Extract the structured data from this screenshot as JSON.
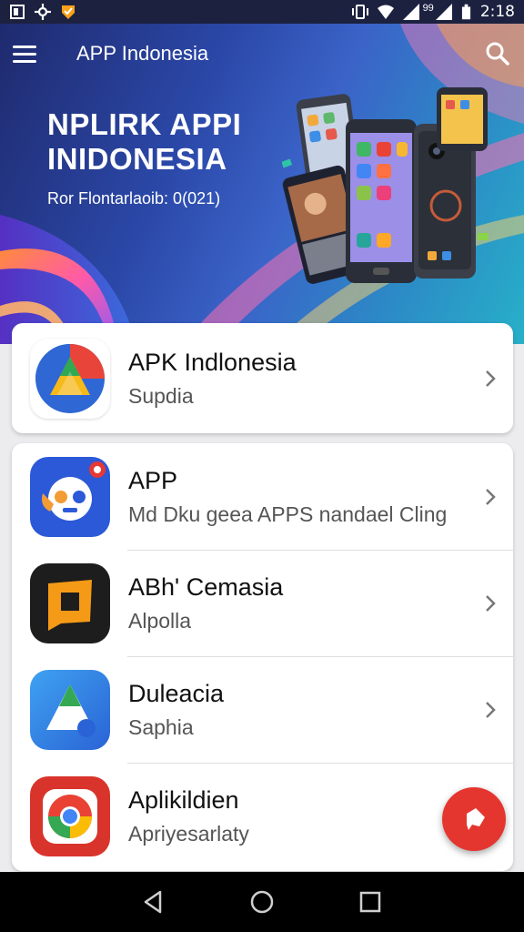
{
  "status_bar": {
    "network_label": "99",
    "time": "2:18",
    "icons": [
      "notification-icon",
      "settings-icon",
      "shield-icon",
      "vibrate-icon",
      "wifi-icon",
      "signal-icon",
      "battery-icon"
    ]
  },
  "header": {
    "title": "APP Indonesia",
    "menu_icon": "hamburger-menu-icon",
    "search_icon": "search-icon"
  },
  "hero": {
    "title_line1": "NPLIRK APPI",
    "title_line2": "INIDONESIA",
    "subtitle": "Ror Flontarlaoib: 0(021)",
    "colors": {
      "gradient_start": "#1f2a6e",
      "gradient_end": "#27b0c8"
    }
  },
  "featured": {
    "title": "APK Indlonesia",
    "subtitle": "Supdia",
    "icon": "google-drive-style-icon"
  },
  "apps": [
    {
      "title": "APP",
      "subtitle": "Md Dku geea APPS nandael Cling",
      "icon": "blue-chat-bot-icon"
    },
    {
      "title": "ABh' Cemasia",
      "subtitle": "Alpolla",
      "icon": "orange-square-icon"
    },
    {
      "title": "Duleacia",
      "subtitle": "Saphia",
      "icon": "blue-triangle-icon"
    },
    {
      "title": "Aplikildien",
      "subtitle": "Apriyesarlaty",
      "icon": "chrome-style-icon"
    }
  ],
  "fab": {
    "icon": "pin-icon",
    "color": "#e5352f"
  },
  "nav": {
    "back_icon": "back-triangle-icon",
    "home_icon": "home-circle-icon",
    "recents_icon": "recents-square-icon"
  }
}
